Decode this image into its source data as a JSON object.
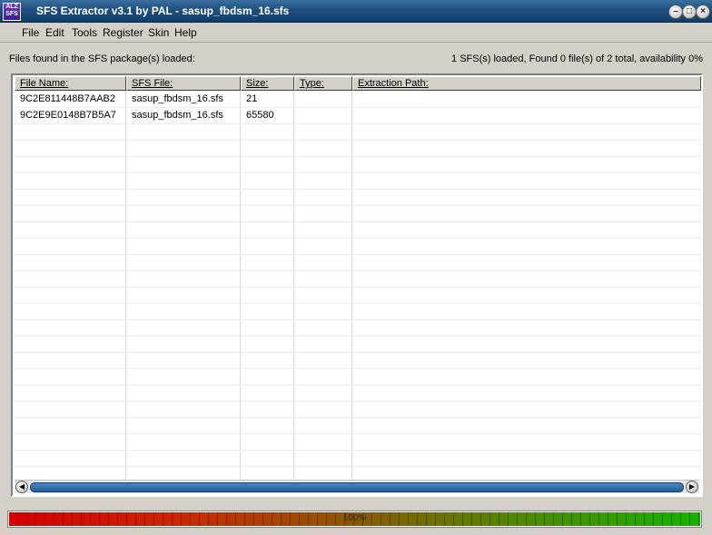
{
  "window": {
    "title": "SFS Extractor v3.1 by PAL - sasup_fbdsm_16.sfs",
    "icon_text": "ALZ SFS",
    "controls": [
      "minimize",
      "maximize",
      "close"
    ]
  },
  "menu": [
    {
      "label": "File"
    },
    {
      "label": "Edit"
    },
    {
      "label": "Tools"
    },
    {
      "label": "Register"
    },
    {
      "label": "Skin"
    },
    {
      "label": "Help"
    }
  ],
  "files_label": "Files found in the SFS package(s) loaded:",
  "status": "1 SFS(s) loaded, Found 0 file(s) of 2 total, availability 0%",
  "table": {
    "columns": [
      "File Name:",
      "SFS File:",
      "Size:",
      "Type:",
      "Extraction Path:"
    ],
    "rows": [
      {
        "file_name": "9C2E811448B7AAB2",
        "sfs_file": "sasup_fbdsm_16.sfs",
        "size": "21",
        "type": "",
        "path": ""
      },
      {
        "file_name": "9C2E9E0148B7B5A7",
        "sfs_file": "sasup_fbdsm_16.sfs",
        "size": "65580",
        "type": "",
        "path": ""
      }
    ]
  },
  "progress": {
    "value": 1.0,
    "label": "100%"
  },
  "colors": {
    "titlebar": "#1d4f80",
    "progress_start": "#d40000",
    "progress_end": "#1ab000"
  }
}
